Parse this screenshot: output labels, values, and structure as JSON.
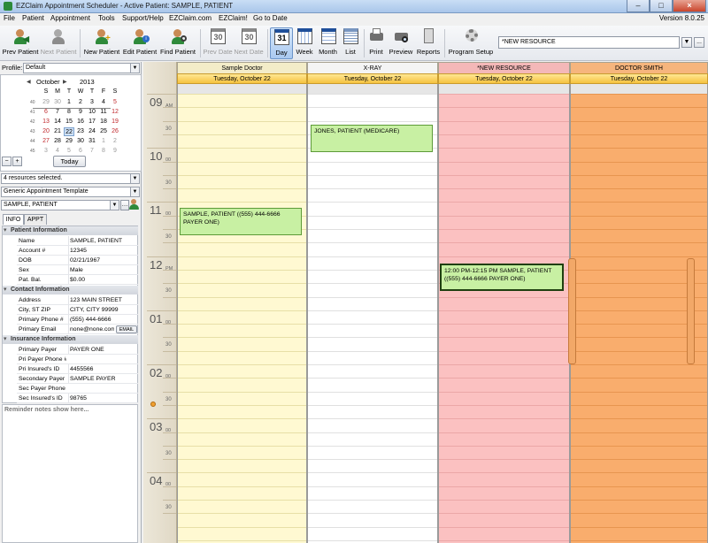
{
  "window": {
    "title": "EZClaim Appointment Scheduler - Active Patient: SAMPLE, PATIENT",
    "min": "–",
    "max": "□",
    "close": "×"
  },
  "menu": {
    "items": [
      "File",
      "Patient",
      "Appointment",
      "Tools",
      "Support/Help",
      "EZClaim.com",
      "EZClaim!",
      "Go to Date"
    ],
    "version": "Version 8.0.25"
  },
  "toolbar": {
    "prev_patient": "Prev Patient",
    "next_patient": "Next Patient",
    "new_patient": "New Patient",
    "edit_patient": "Edit Patient",
    "find_patient": "Find Patient",
    "prev_date": "Prev Date",
    "next_date": "Next Date",
    "day": "Day",
    "week": "Week",
    "month": "Month",
    "list": "List",
    "print": "Print",
    "preview": "Preview",
    "reports": "Reports",
    "program_setup": "Program Setup",
    "day_icon_num": "31",
    "prev_date_num": "30",
    "next_date_num": "30",
    "resource_select": "*NEW RESOURCE",
    "btn_dropdown": "▼",
    "btn_browse": "..."
  },
  "left": {
    "profile_label": "Profile:",
    "profile_value": "Default",
    "calendar": {
      "month": "October",
      "year": "2013",
      "prev": "◀",
      "next": "▶",
      "weekdays": [
        "S",
        "M",
        "T",
        "W",
        "T",
        "F",
        "S"
      ],
      "weeknums": [
        "40",
        "41",
        "42",
        "43",
        "44",
        "45"
      ],
      "weeks": [
        [
          "29",
          "30",
          "1",
          "2",
          "3",
          "4",
          "5"
        ],
        [
          "6",
          "7",
          "8",
          "9",
          "10",
          "11",
          "12"
        ],
        [
          "13",
          "14",
          "15",
          "16",
          "17",
          "18",
          "19"
        ],
        [
          "20",
          "21",
          "22",
          "23",
          "24",
          "25",
          "26"
        ],
        [
          "27",
          "28",
          "29",
          "30",
          "31",
          "1",
          "2"
        ],
        [
          "3",
          "4",
          "5",
          "6",
          "7",
          "8",
          "9"
        ]
      ]
    },
    "minus": "−",
    "plus": "+",
    "today": "Today",
    "resources": "4 resources selected.",
    "template": "Generic Appointment Template",
    "patient": "SAMPLE, PATIENT",
    "tabs": [
      "INFO",
      "APPT"
    ],
    "patient_info": {
      "title": "Patient Information",
      "rows": [
        [
          "Name",
          "SAMPLE, PATIENT"
        ],
        [
          "Account #",
          "12345"
        ],
        [
          "DOB",
          "02/21/1967"
        ],
        [
          "Sex",
          "Male"
        ],
        [
          "Pat. Bal.",
          "$0.00"
        ]
      ]
    },
    "contact_info": {
      "title": "Contact Information",
      "rows": [
        [
          "Address",
          "123 MAIN STREET"
        ],
        [
          "City, ST ZIP",
          "CITY, CITY 99999"
        ],
        [
          "Primary Phone #",
          "(555) 444-6666"
        ],
        [
          "Primary Email",
          "none@none.com"
        ]
      ],
      "email_btn": "EMAIL"
    },
    "insurance_info": {
      "title": "Insurance Information",
      "rows": [
        [
          "Primary Payer",
          "PAYER ONE"
        ],
        [
          "Pri Payer Phone #",
          ""
        ],
        [
          "Pri Insured's ID",
          "4455566"
        ],
        [
          "Secondary Payer",
          "SAMPLE PAYER"
        ],
        [
          "Sec Payer Phone",
          ""
        ],
        [
          "Sec Insured's ID",
          "98765"
        ]
      ]
    },
    "reminder": "Reminder notes show here..."
  },
  "schedule": {
    "hours": [
      {
        "h": "09",
        "ap": "AM"
      },
      {
        "h": "10",
        "ap": "00"
      },
      {
        "h": "11",
        "ap": "00"
      },
      {
        "h": "12",
        "ap": "PM"
      },
      {
        "h": "01",
        "ap": "00"
      },
      {
        "h": "02",
        "ap": "00"
      },
      {
        "h": "03",
        "ap": "00"
      },
      {
        "h": "04",
        "ap": "00"
      }
    ],
    "half": "30",
    "columns": [
      {
        "name": "Sample Doctor",
        "date": "Tuesday, October 22",
        "bg": "#fff9d2",
        "line": "#e7dfa7",
        "head": "#f3ecc8"
      },
      {
        "name": "X-RAY",
        "date": "Tuesday, October 22",
        "bg": "#ffffff",
        "line": "#e0e0e0",
        "head": "#f4f4f4"
      },
      {
        "name": "*NEW RESOURCE",
        "date": "Tuesday, October 22",
        "bg": "#fbc1c1",
        "line": "#eba7a7",
        "head": "#f4b8b8"
      },
      {
        "name": "DOCTOR SMITH",
        "date": "Tuesday, October 22",
        "bg": "#f9ad6d",
        "line": "#e79550",
        "head": "#f6b57d"
      }
    ],
    "appointments": [
      {
        "col": 0,
        "text": "SAMPLE, PATIENT ((555) 444-6666 PAYER ONE)"
      },
      {
        "col": 1,
        "text": "JONES, PATIENT (MEDICARE)"
      },
      {
        "col": 2,
        "text": "12:00 PM-12:15 PM SAMPLE, PATIENT ((555) 444-6666 PAYER ONE)"
      }
    ]
  }
}
